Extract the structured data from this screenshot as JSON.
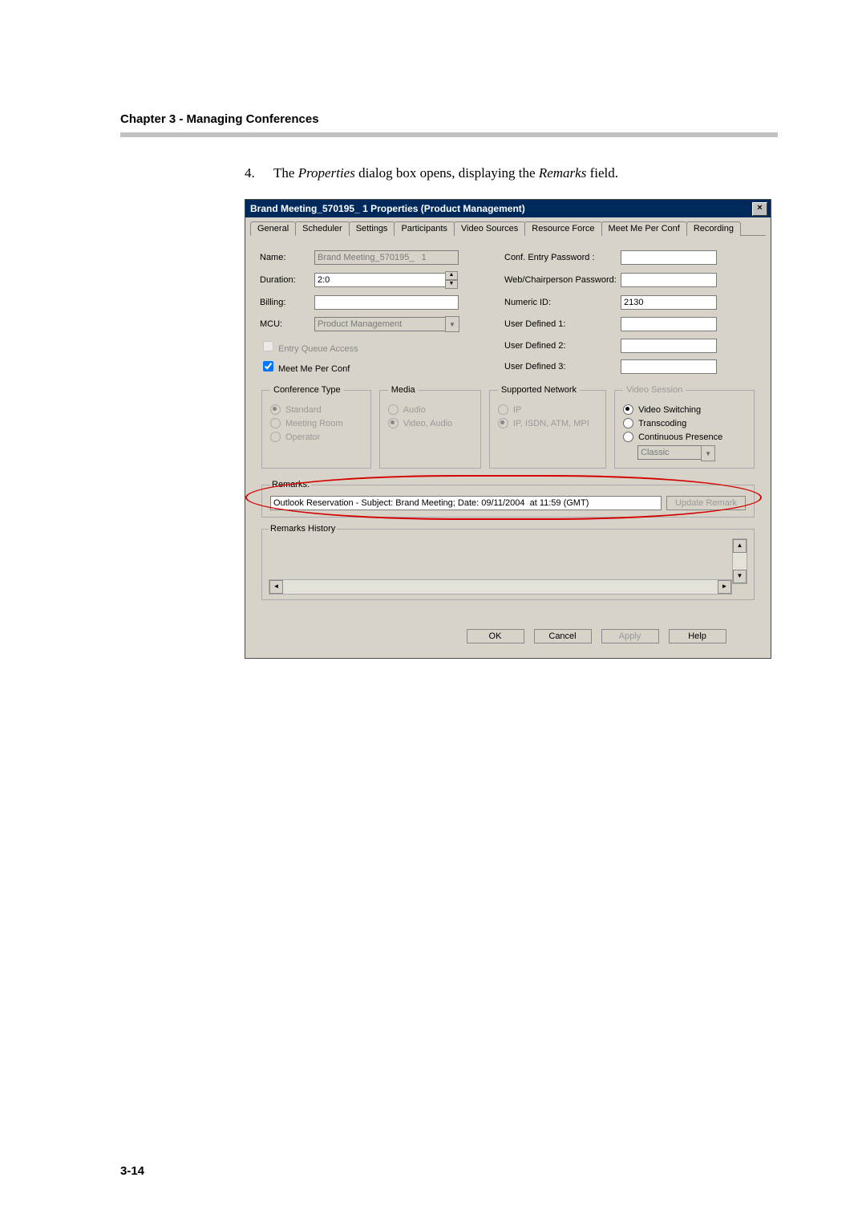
{
  "doc": {
    "chapter_header": "Chapter 3 - Managing Conferences",
    "step_number": "4.",
    "step_text_before_italic1": "The ",
    "step_italic1": "Properties",
    "step_text_mid": " dialog box opens, displaying the ",
    "step_italic2": "Remarks",
    "step_text_after": " field.",
    "page_number": "3-14"
  },
  "dialog": {
    "title": "Brand Meeting_570195_   1 Properties  (Product Management)",
    "close": "×",
    "tabs": [
      "General",
      "Scheduler",
      "Settings",
      "Participants",
      "Video Sources",
      "Resource Force",
      "Meet Me Per Conf",
      "Recording"
    ],
    "labels": {
      "name": "Name:",
      "duration": "Duration:",
      "billing": "Billing:",
      "mcu": "MCU:",
      "entry_queue": "Entry Queue Access",
      "meet_me": "Meet Me Per Conf",
      "conf_entry_pw": "Conf. Entry Password :",
      "web_pw": "Web/Chairperson Password:",
      "numeric_id": "Numeric ID:",
      "ud1": "User Defined 1:",
      "ud2": "User Defined 2:",
      "ud3": "User Defined 3:"
    },
    "values": {
      "name": "Brand Meeting_570195_   1",
      "duration": "2:0",
      "mcu": "Product Management",
      "numeric_id": "2130",
      "remarks": "Outlook Reservation - Subject: Brand Meeting; Date: 09/11/2004  at 11:59 (GMT)"
    },
    "groups": {
      "conf_type": {
        "legend": "Conference Type",
        "opts": [
          "Standard",
          "Meeting Room",
          "Operator"
        ],
        "selected": 0
      },
      "media": {
        "legend": "Media",
        "opts": [
          "Audio",
          "Video, Audio"
        ],
        "selected": 1
      },
      "network": {
        "legend": "Supported Network",
        "opts": [
          "IP",
          "IP, ISDN, ATM, MPI"
        ],
        "selected": 1
      },
      "video_session": {
        "legend": "Video Session",
        "opts": [
          "Video Switching",
          "Transcoding",
          "Continuous Presence"
        ],
        "selected": 0,
        "cp_value": "Classic"
      }
    },
    "remarks_legend": "Remarks:",
    "update_remark": "Update Remark",
    "history_legend": "Remarks History",
    "buttons": {
      "ok": "OK",
      "cancel": "Cancel",
      "apply": "Apply",
      "help": "Help"
    }
  }
}
